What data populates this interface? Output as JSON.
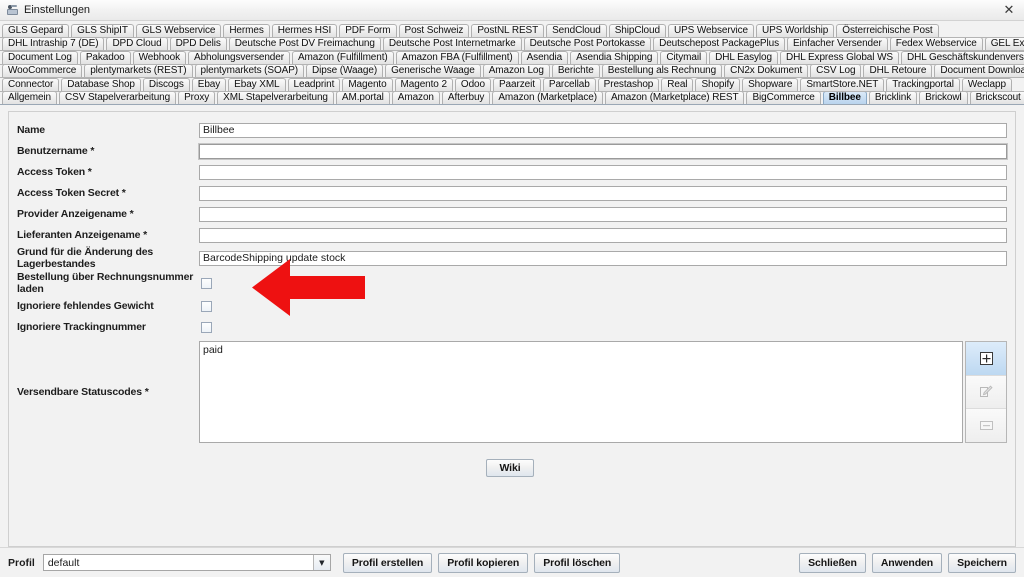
{
  "window": {
    "title": "Einstellungen",
    "icon": "settings-icon",
    "close_label": "✕"
  },
  "tab_rows": [
    {
      "tabs": [
        {
          "label": "GLS Gepard"
        },
        {
          "label": "GLS ShipIT"
        },
        {
          "label": "GLS Webservice"
        },
        {
          "label": "Hermes"
        },
        {
          "label": "Hermes HSI"
        },
        {
          "label": "PDF Form"
        },
        {
          "label": "Post Schweiz"
        },
        {
          "label": "PostNL REST"
        },
        {
          "label": "SendCloud"
        },
        {
          "label": "ShipCloud"
        },
        {
          "label": "UPS Webservice"
        },
        {
          "label": "UPS Worldship"
        },
        {
          "label": "Österreichische Post"
        }
      ]
    },
    {
      "tabs": [
        {
          "label": "DHL Intraship 7 (DE)"
        },
        {
          "label": "DPD Cloud"
        },
        {
          "label": "DPD Delis"
        },
        {
          "label": "Deutsche Post DV Freimachung"
        },
        {
          "label": "Deutsche Post Internetmarke"
        },
        {
          "label": "Deutsche Post Portokasse"
        },
        {
          "label": "Deutschepost PackagePlus"
        },
        {
          "label": "Einfacher Versender"
        },
        {
          "label": "Fedex Webservice"
        },
        {
          "label": "GEL Express"
        }
      ]
    },
    {
      "tabs": [
        {
          "label": "Document Log"
        },
        {
          "label": "Pakadoo"
        },
        {
          "label": "Webhook"
        },
        {
          "label": "Abholungsversender"
        },
        {
          "label": "Amazon (Fulfillment)"
        },
        {
          "label": "Amazon FBA (Fulfillment)"
        },
        {
          "label": "Asendia"
        },
        {
          "label": "Asendia Shipping"
        },
        {
          "label": "Citymail"
        },
        {
          "label": "DHL Easylog"
        },
        {
          "label": "DHL Express Global WS"
        },
        {
          "label": "DHL Geschäftskundenversand"
        }
      ]
    },
    {
      "tabs": [
        {
          "label": "WooCommerce"
        },
        {
          "label": "plentymarkets (REST)"
        },
        {
          "label": "plentymarkets (SOAP)"
        },
        {
          "label": "Dipse (Waage)"
        },
        {
          "label": "Generische Waage"
        },
        {
          "label": "Amazon Log"
        },
        {
          "label": "Berichte"
        },
        {
          "label": "Bestellung als Rechnung"
        },
        {
          "label": "CN2x Dokument"
        },
        {
          "label": "CSV Log"
        },
        {
          "label": "DHL Retoure"
        },
        {
          "label": "Document Downloader"
        }
      ]
    },
    {
      "tabs": [
        {
          "label": "Connector"
        },
        {
          "label": "Database Shop"
        },
        {
          "label": "Discogs"
        },
        {
          "label": "Ebay"
        },
        {
          "label": "Ebay XML"
        },
        {
          "label": "Leadprint"
        },
        {
          "label": "Magento"
        },
        {
          "label": "Magento 2"
        },
        {
          "label": "Odoo"
        },
        {
          "label": "Paarzeit"
        },
        {
          "label": "Parcellab"
        },
        {
          "label": "Prestashop"
        },
        {
          "label": "Real"
        },
        {
          "label": "Shopify"
        },
        {
          "label": "Shopware"
        },
        {
          "label": "SmartStore.NET"
        },
        {
          "label": "Trackingportal"
        },
        {
          "label": "Weclapp"
        }
      ]
    },
    {
      "tabs": [
        {
          "label": "Allgemein"
        },
        {
          "label": "CSV Stapelverarbeitung"
        },
        {
          "label": "Proxy"
        },
        {
          "label": "XML Stapelverarbeitung"
        },
        {
          "label": "AM.portal"
        },
        {
          "label": "Amazon"
        },
        {
          "label": "Afterbuy"
        },
        {
          "label": "Amazon (Marketplace)"
        },
        {
          "label": "Amazon (Marketplace) REST"
        },
        {
          "label": "BigCommerce"
        },
        {
          "label": "Billbee",
          "selected": true
        },
        {
          "label": "Bricklink"
        },
        {
          "label": "Brickowl"
        },
        {
          "label": "Brickscout"
        }
      ]
    }
  ],
  "form": {
    "fields": [
      {
        "label": "Name",
        "value": "Billbee",
        "placeholder": "",
        "type": "text"
      },
      {
        "label": "Benutzername *",
        "value": "",
        "placeholder": "",
        "type": "text",
        "focused": true
      },
      {
        "label": "Access Token *",
        "value": "",
        "placeholder": "",
        "type": "text"
      },
      {
        "label": "Access Token Secret *",
        "value": "",
        "placeholder": "",
        "type": "text"
      },
      {
        "label": "Provider Anzeigename *",
        "value": "",
        "placeholder": "",
        "type": "text"
      },
      {
        "label": "Lieferanten Anzeigename *",
        "value": "",
        "placeholder": "",
        "type": "text"
      },
      {
        "label": "Grund für die Änderung des Lagerbestandes",
        "value": "BarcodeShipping update stock",
        "placeholder": "",
        "type": "text"
      }
    ],
    "checkboxes": [
      {
        "label": "Bestellung über Rechnungsnummer laden",
        "checked": false
      },
      {
        "label": "Ignoriere fehlendes Gewicht",
        "checked": false
      },
      {
        "label": "Ignoriere Trackingnummer",
        "checked": false
      }
    ],
    "statuscodes": {
      "label": "Versendbare Statuscodes *",
      "items": [
        "paid"
      ],
      "buttons": [
        {
          "icon": "plus-box-icon",
          "enabled": true
        },
        {
          "icon": "edit-pencil-icon",
          "enabled": false
        },
        {
          "icon": "minus-box-icon",
          "enabled": false
        }
      ]
    },
    "wiki_label": "Wiki"
  },
  "bottom": {
    "profile_label": "Profil",
    "profile_value": "default",
    "profile_arrow": "▼",
    "buttons": [
      {
        "label": "Profil erstellen"
      },
      {
        "label": "Profil kopieren"
      },
      {
        "label": "Profil löschen"
      }
    ],
    "actions": [
      {
        "label": "Schließen"
      },
      {
        "label": "Anwenden"
      },
      {
        "label": "Speichern"
      }
    ]
  },
  "annotation": {
    "arrow_color": "#ee1111",
    "arrow_direction": "left",
    "points_at": "Benutzername *"
  }
}
